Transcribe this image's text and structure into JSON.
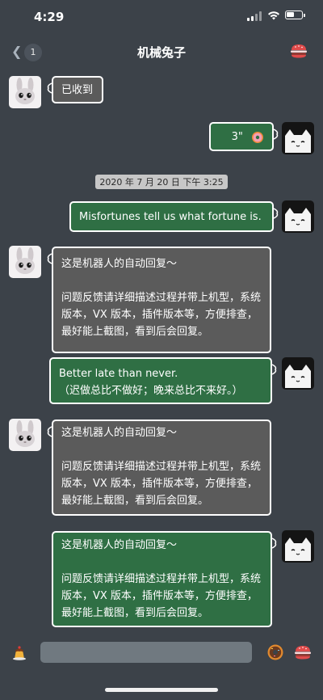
{
  "status_bar": {
    "time": "4:29",
    "battery_level": 0.55
  },
  "header": {
    "unread_count": "1",
    "title": "机械兔子"
  },
  "messages": [
    {
      "side": "left",
      "avatar": "rabbit-avatar",
      "style": "gray",
      "text": "已收到"
    },
    {
      "side": "right",
      "avatar": "cat-avatar",
      "style": "green",
      "text": "3\"",
      "extra_icon": "donut-icon"
    },
    {
      "type": "timestamp",
      "text": "2020 年 7 月 20 日 下午 3:25"
    },
    {
      "side": "right",
      "avatar": "cat-avatar",
      "style": "green",
      "text": "Misfortunes tell us what fortune is."
    },
    {
      "side": "left",
      "avatar": "rabbit-avatar",
      "style": "gray",
      "text": "这是机器人的自动回复～\n\n问题反馈请详细描述过程并带上机型，系统版本，VX 版本，插件版本等，方便排查，最好能上截图，看到后会回复。"
    },
    {
      "side": "right",
      "avatar": "cat-avatar",
      "style": "green",
      "text": "Better late than never.\n（迟做总比不做好；晚来总比不来好。）"
    },
    {
      "side": "left",
      "avatar": "rabbit-avatar",
      "style": "gray",
      "text": "这是机器人的自动回复～\n\n问题反馈请详细描述过程并带上机型，系统版本，VX 版本，插件版本等，方便排查，最好能上截图，看到后会回复。"
    },
    {
      "side": "right",
      "avatar": "cat-avatar",
      "style": "green",
      "text": "这是机器人的自动回复～\n\n问题反馈请详细描述过程并带上机型，系统版本，VX 版本，插件版本等，方便排查，最好能上截图，看到后会回复。"
    }
  ],
  "input_bar": {
    "placeholder": "",
    "left_icon": "pudding-icon",
    "right_icons": [
      "donut-icon",
      "burger-icon"
    ]
  },
  "colors": {
    "background": "#3c4249",
    "gray_bubble": "#5b5b5b",
    "green_bubble": "#2f6f44"
  }
}
